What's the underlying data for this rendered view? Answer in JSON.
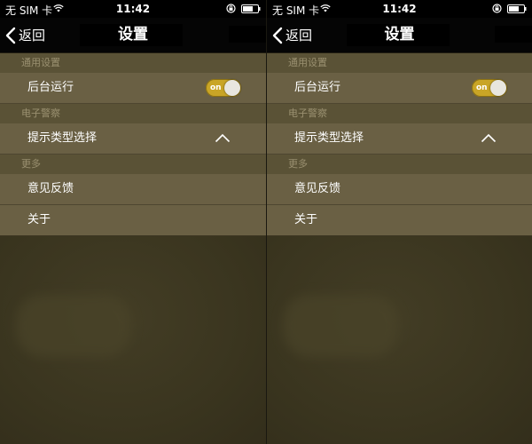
{
  "status_bar": {
    "carrier": "无 SIM 卡",
    "time": "11:42"
  },
  "nav": {
    "back_label": "返回",
    "title": "设置"
  },
  "sections": [
    {
      "header": "通用设置",
      "rows": [
        {
          "label": "后台运行",
          "control": "toggle",
          "toggle_state": "ON",
          "toggle_text": "on"
        }
      ]
    },
    {
      "header": "电子警察",
      "rows": [
        {
          "label": "提示类型选择",
          "control": "chevron-up"
        }
      ]
    },
    {
      "header": "更多",
      "rows": [
        {
          "label": "意见反馈"
        },
        {
          "label": "关于"
        }
      ]
    }
  ],
  "colors": {
    "toggle_on": "#c9a526",
    "row_background": "#6a6044",
    "section_background": "#5a5236",
    "page_background": "#3a351f"
  },
  "icons": [
    "wifi-icon",
    "lock-icon",
    "battery-icon",
    "back-chevron-icon",
    "chevron-up-icon"
  ]
}
